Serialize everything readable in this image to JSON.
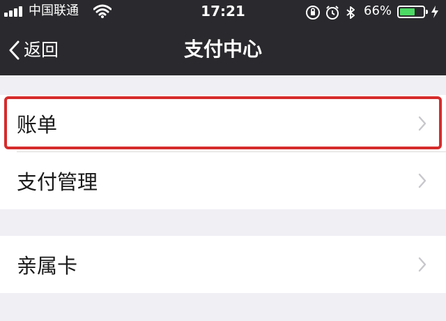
{
  "status_bar": {
    "carrier": "中国联通",
    "time": "17:21",
    "battery_percent": "66%",
    "battery_level": 0.66,
    "icons": [
      "signal-icon",
      "wifi-icon",
      "orientation-lock-icon",
      "alarm-icon",
      "bluetooth-icon",
      "battery-icon",
      "charging-icon"
    ],
    "battery_color": "#4cd964"
  },
  "nav": {
    "back_label": "返回",
    "title": "支付中心"
  },
  "groups": [
    {
      "items": [
        {
          "label": "账单",
          "highlighted": true
        },
        {
          "label": "支付管理"
        }
      ]
    },
    {
      "items": [
        {
          "label": "亲属卡"
        }
      ]
    }
  ],
  "colors": {
    "nav_background": "#2a2a2e",
    "page_background": "#efeff4",
    "highlight_border": "#d62b2b"
  }
}
